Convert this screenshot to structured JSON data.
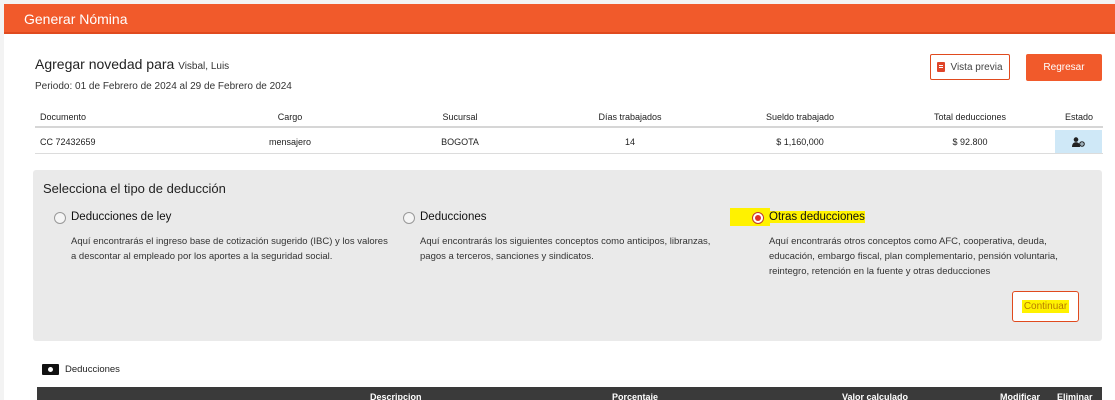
{
  "window": {
    "title": "Generar Nómina"
  },
  "header": {
    "heading": "Agregar novedad para",
    "employee_name": "Visbal, Luis",
    "period": "Periodo: 01 de Febrero de 2024 al 29 de Febrero de 2024",
    "preview_label": "Vista previa",
    "back_label": "Regresar"
  },
  "table": {
    "columns": [
      "Documento",
      "Cargo",
      "Sucursal",
      "Días trabajados",
      "Sueldo trabajado",
      "Total deducciones",
      "Estado"
    ],
    "rows": [
      {
        "documento": "CC 72432659",
        "cargo": "mensajero",
        "sucursal": "BOGOTA",
        "dias": "14",
        "sueldo": "$ 1,160,000",
        "deducciones": "$ 92.800",
        "estado_icon": "user-gear-icon"
      }
    ]
  },
  "deduction_type": {
    "title": "Selecciona el tipo de deducción",
    "selected": "Otras deducciones",
    "options": [
      {
        "label": "Deducciones de ley",
        "description": "Aquí encontrarás el ingreso base de cotización sugerido (IBC) y los valores a descontar al empleado por los aportes a la seguridad social."
      },
      {
        "label": "Deducciones",
        "description": "Aquí encontrarás los siguientes conceptos como anticipos, libranzas, pagos a terceros, sanciones y sindicatos."
      },
      {
        "label": "Otras deducciones",
        "description": "Aquí encontrarás otros conceptos como AFC, cooperativa, deuda, educación, embargo fiscal, plan complementario, pensión voluntaria, reintegro, retención en la fuente y otras deducciones"
      }
    ],
    "continue_label": "Continuar"
  },
  "deductions_section": {
    "label": "Deducciones",
    "columns": [
      "Descripcion",
      "Porcentaje",
      "Valor calculado",
      "Modificar",
      "Eliminar"
    ]
  },
  "colors": {
    "accent": "#f15a2b",
    "highlight": "#fff200",
    "state_cell": "#cfe8f7",
    "dark_header": "#3a3a3a"
  }
}
